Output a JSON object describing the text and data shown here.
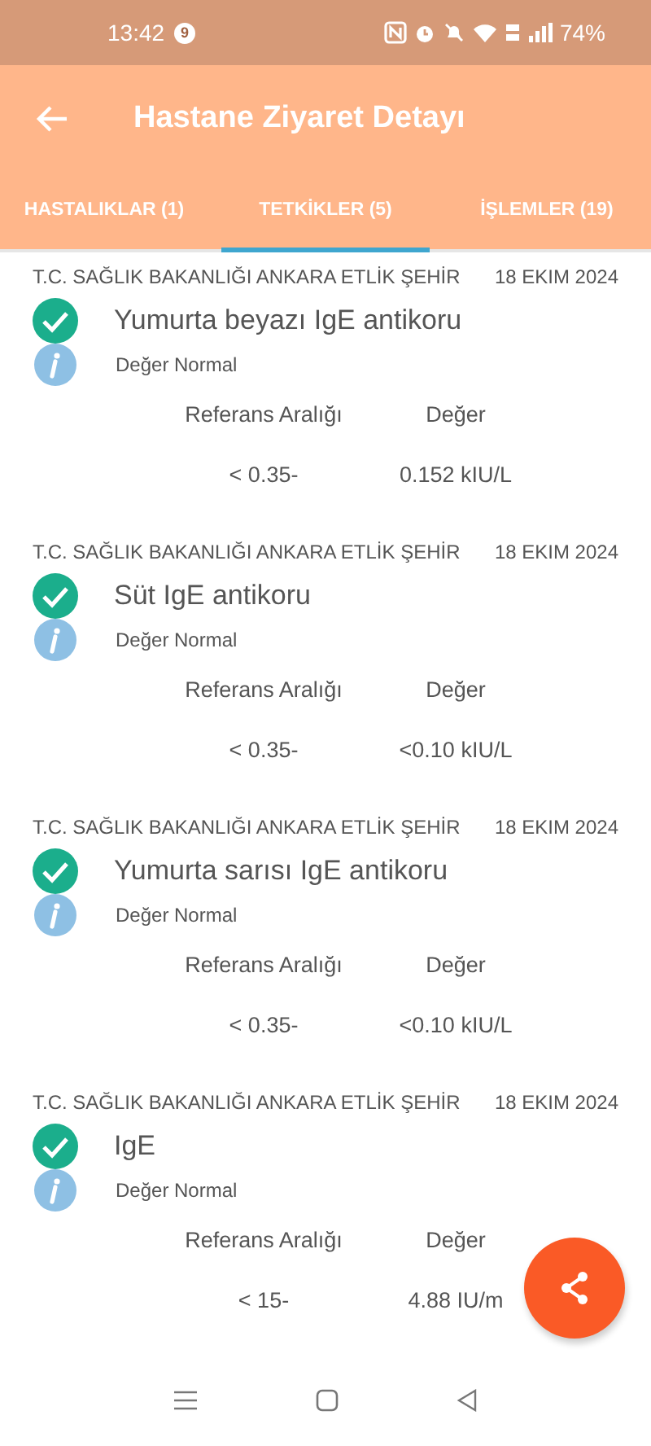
{
  "status_bar": {
    "time": "13:42",
    "notification_count": "9",
    "battery": "74%"
  },
  "app_bar": {
    "title": "Hastane Ziyaret Detayı"
  },
  "tabs": [
    {
      "label": "HASTALIKLAR (1)",
      "selected": false
    },
    {
      "label": "TETKİKLER (5)",
      "selected": true
    },
    {
      "label": "İŞLEMLER (19)",
      "selected": false
    }
  ],
  "tests": [
    {
      "hospital": "T.C. SAĞLIK BAKANLIĞI ANKARA ETLİK ŞEHİR",
      "date": "18 EKIM 2024",
      "name": "Yumurta beyazı IgE antikoru",
      "status": "Değer Normal",
      "range_label": "Referans Aralığı",
      "value_label": "Değer",
      "range": "< 0.35-",
      "value": "0.152 kIU/L"
    },
    {
      "hospital": "T.C. SAĞLIK BAKANLIĞI ANKARA ETLİK ŞEHİR",
      "date": "18 EKIM 2024",
      "name": "Süt IgE antikoru",
      "status": "Değer Normal",
      "range_label": "Referans Aralığı",
      "value_label": "Değer",
      "range": "< 0.35-",
      "value": "<0.10 kIU/L"
    },
    {
      "hospital": "T.C. SAĞLIK BAKANLIĞI ANKARA ETLİK ŞEHİR",
      "date": "18 EKIM 2024",
      "name": "Yumurta sarısı IgE antikoru",
      "status": "Değer Normal",
      "range_label": "Referans Aralığı",
      "value_label": "Değer",
      "range": "< 0.35-",
      "value": "<0.10 kIU/L"
    },
    {
      "hospital": "T.C. SAĞLIK BAKANLIĞI ANKARA ETLİK ŞEHİR",
      "date": "18 EKIM 2024",
      "name": "IgE",
      "status": "Değer Normal",
      "range_label": "Referans Aralığı",
      "value_label": "Değer",
      "range": "< 15-",
      "value": "4.88 IU/m"
    }
  ]
}
